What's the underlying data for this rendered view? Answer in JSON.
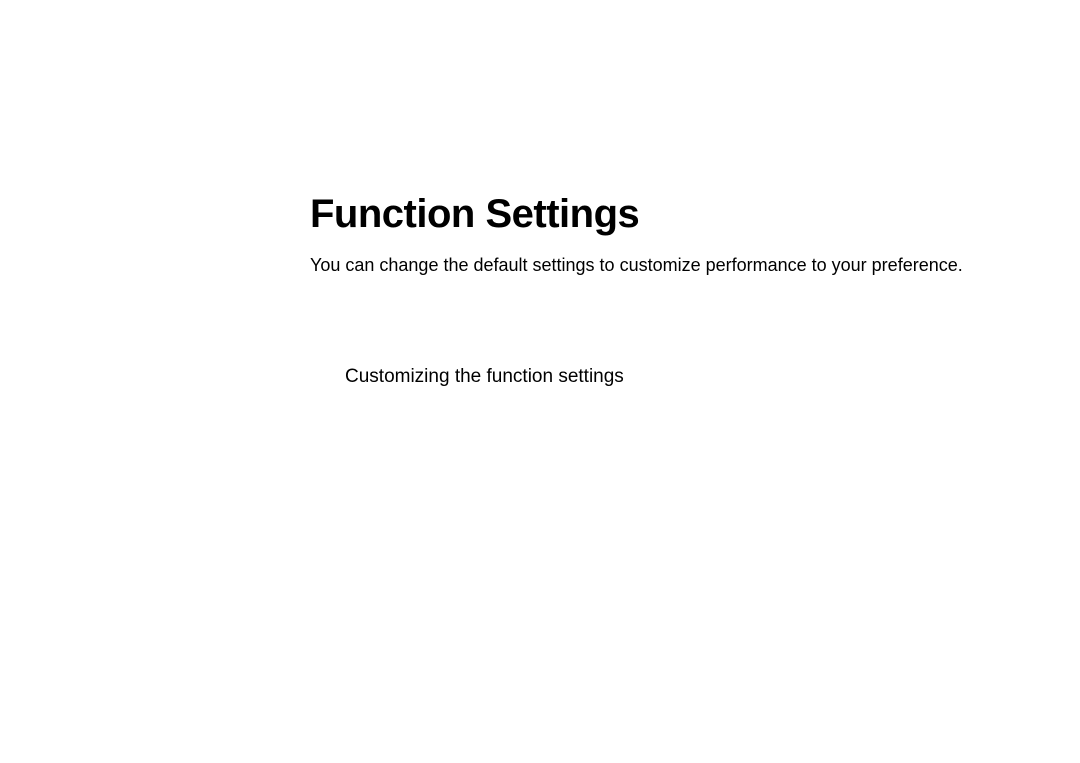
{
  "header": {
    "title": "Function Settings",
    "description": "You can change the default settings to customize performance to your preference."
  },
  "section": {
    "heading": "Customizing the function settings"
  }
}
